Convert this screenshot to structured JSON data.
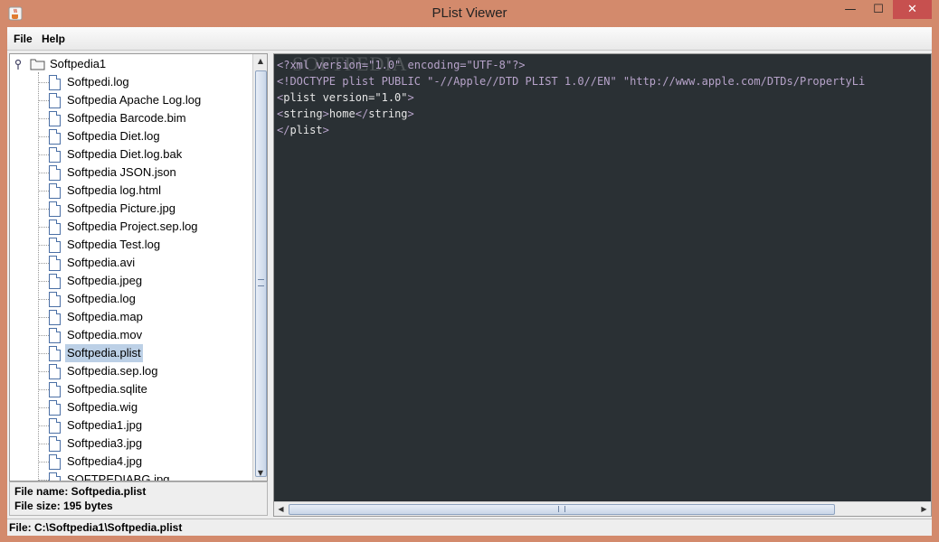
{
  "window": {
    "title": "PList Viewer",
    "icon": "java-cup-icon",
    "controls": {
      "minimize": "—",
      "maximize": "☐",
      "close": "✕"
    }
  },
  "menu": {
    "file": "File",
    "help": "Help"
  },
  "tree": {
    "root": "Softpedia1",
    "items": [
      "Softpedi.log",
      "Softpedia Apache Log.log",
      "Softpedia Barcode.bim",
      "Softpedia Diet.log",
      "Softpedia Diet.log.bak",
      "Softpedia JSON.json",
      "Softpedia log.html",
      "Softpedia Picture.jpg",
      "Softpedia Project.sep.log",
      "Softpedia Test.log",
      "Softpedia.avi",
      "Softpedia.jpeg",
      "Softpedia.log",
      "Softpedia.map",
      "Softpedia.mov",
      "Softpedia.plist",
      "Softpedia.sep.log",
      "Softpedia.sqlite",
      "Softpedia.wig",
      "Softpedia1.jpg",
      "Softpedia3.jpg",
      "Softpedia4.jpg",
      "SOFTPEDIABG.jpg"
    ],
    "selected_index": 15
  },
  "info": {
    "file_name": "File name: Softpedia.plist",
    "file_size": "File size: 195 bytes"
  },
  "code": {
    "watermark": "SOFTPEDIA",
    "lines": [
      [
        [
          "tag",
          "<?xml version=\"1.0\" encoding=\"UTF-8\"?>"
        ]
      ],
      [
        [
          "tag",
          "<!DOCTYPE plist PUBLIC \"-//Apple//DTD PLIST 1.0//EN\" \"http://www.apple.com/DTDs/PropertyLi"
        ]
      ],
      [
        [
          "tag",
          "<"
        ],
        [
          "text",
          "plist version=\"1.0\""
        ],
        [
          "tag",
          ">"
        ]
      ],
      [
        [
          "tag",
          "<"
        ],
        [
          "text",
          "string"
        ],
        [
          "tag",
          ">"
        ],
        [
          "text",
          "home"
        ],
        [
          "tag",
          "</"
        ],
        [
          "text",
          "string"
        ],
        [
          "tag",
          ">"
        ]
      ],
      [
        [
          "tag",
          "</"
        ],
        [
          "text",
          "plist"
        ],
        [
          "tag",
          ">"
        ]
      ]
    ]
  },
  "status": {
    "text": "File: C:\\Softpedia1\\Softpedia.plist"
  },
  "colors": {
    "title_bar": "#d38a6c",
    "editor_background": "#2a3034",
    "tag_color": "#b7a3ca",
    "selection": "#bcd0e6",
    "close_button": "#c7504f"
  }
}
